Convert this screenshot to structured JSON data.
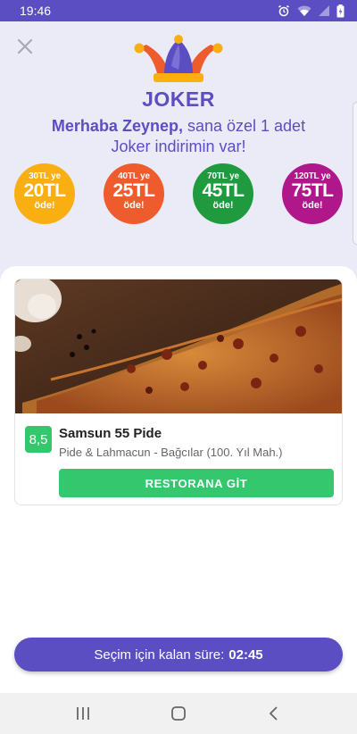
{
  "status_bar": {
    "time": "19:46",
    "icons": [
      "alarm-icon",
      "wifi-icon",
      "signal-icon",
      "battery-icon"
    ]
  },
  "header": {
    "logo_text": "JOKER",
    "greeting_name": "Merhaba Zeynep,",
    "greeting_rest": " sana özel 1 adet",
    "greeting_line2": "Joker indirimin var!"
  },
  "discounts": [
    {
      "top": "30TL ye",
      "amount": "20TL",
      "bottom": "öde!",
      "color": "#f9ae12"
    },
    {
      "top": "40TL ye",
      "amount": "25TL",
      "bottom": "öde!",
      "color": "#ee5b2c"
    },
    {
      "top": "70TL ye",
      "amount": "45TL",
      "bottom": "öde!",
      "color": "#1f9a3f"
    },
    {
      "top": "120TL ye",
      "amount": "75TL",
      "bottom": "öde!",
      "color": "#b0178a"
    }
  ],
  "restaurant": {
    "rating": "8,5",
    "name": "Samsun 55 Pide",
    "category": "Pide & Lahmacun - Bağcılar (100. Yıl Mah.)",
    "button_label": "RESTORANA GİT"
  },
  "timer": {
    "label": "Seçim için kalan süre:",
    "value": "02:45"
  },
  "colors": {
    "brand": "#5a4ec2",
    "accent_green": "#35c76e",
    "background_top": "#ebebf7"
  }
}
